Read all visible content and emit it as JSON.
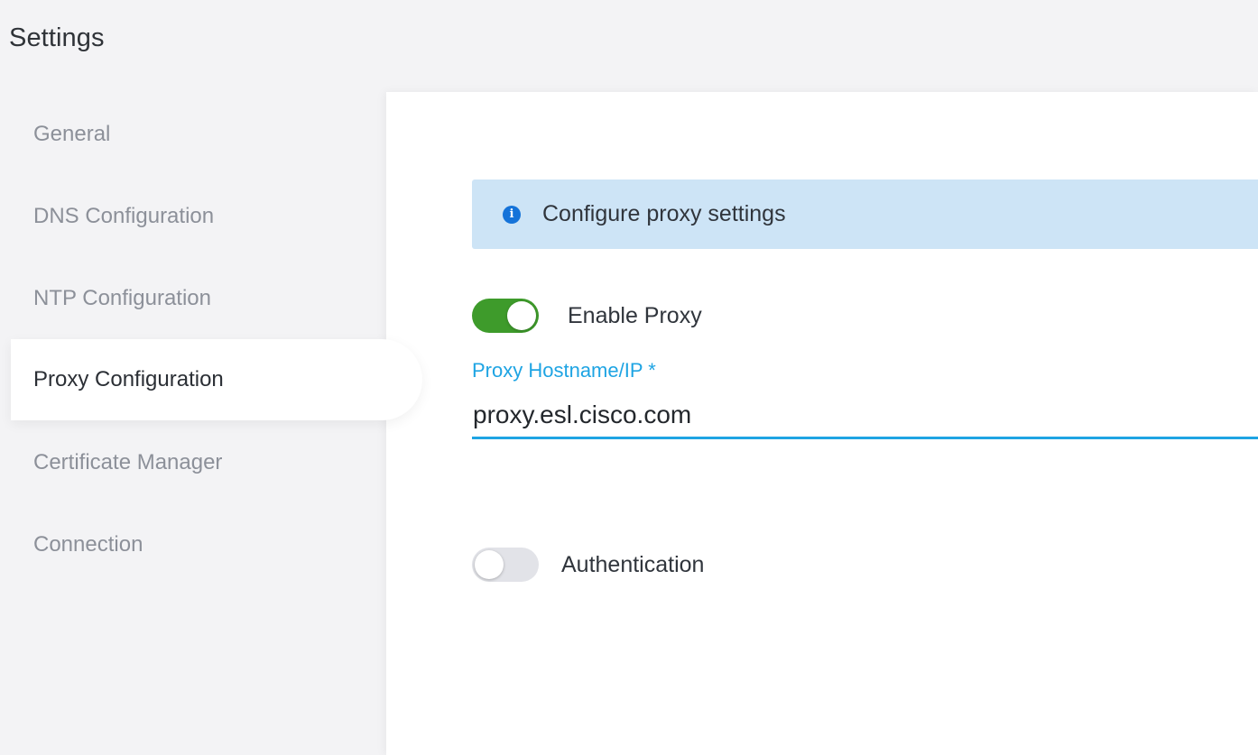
{
  "header": {
    "title": "Settings"
  },
  "sidebar": {
    "items": [
      {
        "label": "General",
        "active": false
      },
      {
        "label": "DNS Configuration",
        "active": false
      },
      {
        "label": "NTP Configuration",
        "active": false
      },
      {
        "label": "Proxy Configuration",
        "active": true
      },
      {
        "label": "Certificate Manager",
        "active": false
      },
      {
        "label": "Connection",
        "active": false
      }
    ]
  },
  "main": {
    "info_banner": {
      "icon": "info-icon",
      "icon_glyph": "i",
      "text": "Configure proxy settings"
    },
    "enable_proxy": {
      "label": "Enable Proxy",
      "enabled": true
    },
    "proxy_hostname": {
      "label": "Proxy Hostname/IP *",
      "value": "proxy.esl.cisco.com"
    },
    "authentication": {
      "label": "Authentication",
      "enabled": false
    }
  },
  "colors": {
    "accent": "#1ea4e3",
    "toggle_on": "#3e9b2b",
    "toggle_off": "#e2e3e8",
    "info_banner_bg": "#cde4f6",
    "info_icon": "#1573d9"
  }
}
